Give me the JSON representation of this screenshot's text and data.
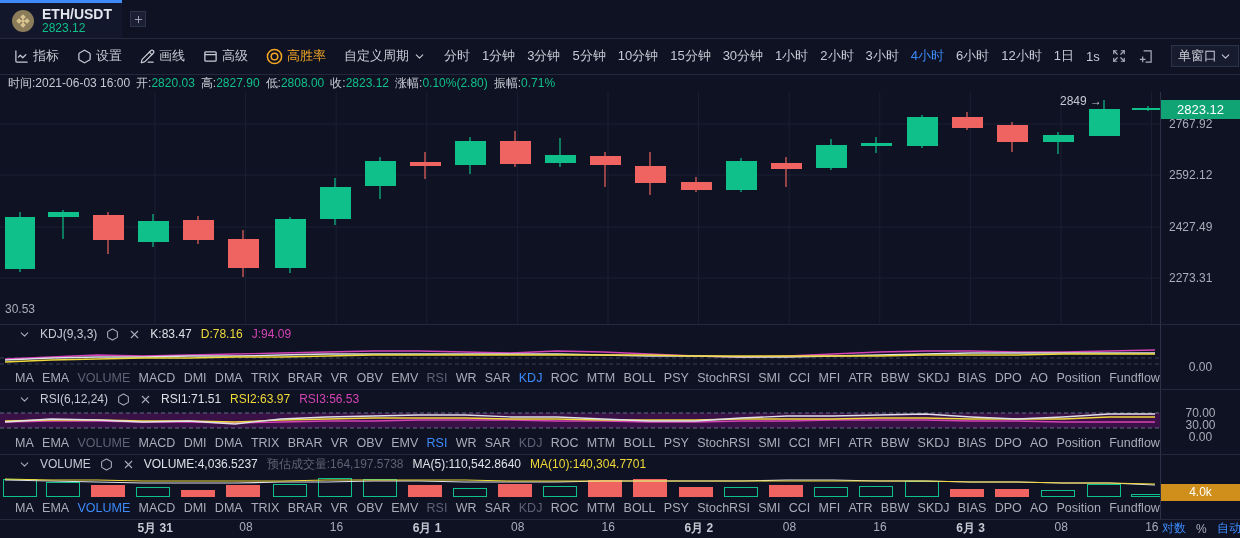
{
  "tab": {
    "symbol": "ETH/USDT",
    "price": "2823.12",
    "selected": true
  },
  "toolbar": {
    "tools": [
      {
        "kind": "indicator",
        "label": "指标"
      },
      {
        "kind": "settings",
        "label": "设置"
      },
      {
        "kind": "draw",
        "label": "画线"
      },
      {
        "kind": "advanced",
        "label": "高级"
      },
      {
        "kind": "winrate",
        "label": "高胜率"
      }
    ],
    "custom_period": "自定义周期",
    "intervals": [
      {
        "label": "分时",
        "selected": false
      },
      {
        "label": "1分钟",
        "selected": false
      },
      {
        "label": "3分钟",
        "selected": false
      },
      {
        "label": "5分钟",
        "selected": false
      },
      {
        "label": "10分钟",
        "selected": false
      },
      {
        "label": "15分钟",
        "selected": false
      },
      {
        "label": "30分钟",
        "selected": false
      },
      {
        "label": "1小时",
        "selected": false
      },
      {
        "label": "2小时",
        "selected": false
      },
      {
        "label": "3小时",
        "selected": false
      },
      {
        "label": "4小时",
        "selected": true
      },
      {
        "label": "6小时",
        "selected": false
      },
      {
        "label": "12小时",
        "selected": false
      },
      {
        "label": "1日",
        "selected": false
      },
      {
        "label": "1s",
        "selected": false
      }
    ],
    "layout_button": "单窗口"
  },
  "info": [
    {
      "label": "时间:",
      "value": "2021-06-03 16:00",
      "kind": "plain"
    },
    {
      "label": "开:",
      "value": "2820.03",
      "kind": "up"
    },
    {
      "label": "高:",
      "value": "2827.90",
      "kind": "up"
    },
    {
      "label": "低:",
      "value": "2808.00",
      "kind": "up"
    },
    {
      "label": "收:",
      "value": "2823.12",
      "kind": "up"
    },
    {
      "label": "涨幅:",
      "value": "0.10%(2.80)",
      "kind": "up"
    },
    {
      "label": "振幅:",
      "value": "0.71%",
      "kind": "up"
    }
  ],
  "main_chart": {
    "high_marker": "2849 →",
    "last_price": "2823.12",
    "price_axis": [
      "2767.92",
      "2592.12",
      "2427.49",
      "2273.31"
    ],
    "left_axis_label": "30.53"
  },
  "panels": [
    {
      "kind": "kdj",
      "title": "KDJ(9,3,3)",
      "values": [
        {
          "text": "K:83.47",
          "color": "#dfe1e8"
        },
        {
          "text": "D:78.16",
          "color": "#f0d93a"
        },
        {
          "text": "J:94.09",
          "color": "#d443b6"
        }
      ],
      "axis": [
        {
          "text": "0.00",
          "kind": "label"
        }
      ],
      "tabs": [
        {
          "label": "MA",
          "selected": false,
          "disabled": false
        },
        {
          "label": "EMA",
          "selected": false,
          "disabled": false
        },
        {
          "label": "VOLUME",
          "selected": false,
          "disabled": true
        },
        {
          "label": "MACD",
          "selected": false,
          "disabled": false
        },
        {
          "label": "DMI",
          "selected": false,
          "disabled": false
        },
        {
          "label": "DMA",
          "selected": false,
          "disabled": false
        },
        {
          "label": "TRIX",
          "selected": false,
          "disabled": false
        },
        {
          "label": "BRAR",
          "selected": false,
          "disabled": false
        },
        {
          "label": "VR",
          "selected": false,
          "disabled": false
        },
        {
          "label": "OBV",
          "selected": false,
          "disabled": false
        },
        {
          "label": "EMV",
          "selected": false,
          "disabled": false
        },
        {
          "label": "RSI",
          "selected": false,
          "disabled": true
        },
        {
          "label": "WR",
          "selected": false,
          "disabled": false
        },
        {
          "label": "SAR",
          "selected": false,
          "disabled": false
        },
        {
          "label": "KDJ",
          "selected": true,
          "disabled": false
        },
        {
          "label": "ROC",
          "selected": false,
          "disabled": false
        },
        {
          "label": "MTM",
          "selected": false,
          "disabled": false
        },
        {
          "label": "BOLL",
          "selected": false,
          "disabled": false
        },
        {
          "label": "PSY",
          "selected": false,
          "disabled": false
        },
        {
          "label": "StochRSI",
          "selected": false,
          "disabled": false
        },
        {
          "label": "SMI",
          "selected": false,
          "disabled": false
        },
        {
          "label": "CCI",
          "selected": false,
          "disabled": false
        },
        {
          "label": "MFI",
          "selected": false,
          "disabled": false
        },
        {
          "label": "ATR",
          "selected": false,
          "disabled": false
        },
        {
          "label": "BBW",
          "selected": false,
          "disabled": false
        },
        {
          "label": "SKDJ",
          "selected": false,
          "disabled": false
        },
        {
          "label": "BIAS",
          "selected": false,
          "disabled": false
        },
        {
          "label": "DPO",
          "selected": false,
          "disabled": false
        },
        {
          "label": "AO",
          "selected": false,
          "disabled": false
        },
        {
          "label": "Position",
          "selected": false,
          "disabled": false
        },
        {
          "label": "Fundflow",
          "selected": false,
          "disabled": false
        }
      ]
    },
    {
      "kind": "rsi",
      "title": "RSI(6,12,24)",
      "values": [
        {
          "text": "RSI1:71.51",
          "color": "#dfe1e8"
        },
        {
          "text": "RSI2:63.97",
          "color": "#f0d93a"
        },
        {
          "text": "RSI3:56.53",
          "color": "#d443b6"
        }
      ],
      "axis": [
        {
          "text": "70.00",
          "kind": "label"
        },
        {
          "text": "30.00",
          "kind": "label"
        },
        {
          "text": "0.00",
          "kind": "label"
        }
      ],
      "tabs": [
        {
          "label": "MA",
          "selected": false,
          "disabled": false
        },
        {
          "label": "EMA",
          "selected": false,
          "disabled": false
        },
        {
          "label": "VOLUME",
          "selected": false,
          "disabled": true
        },
        {
          "label": "MACD",
          "selected": false,
          "disabled": false
        },
        {
          "label": "DMI",
          "selected": false,
          "disabled": false
        },
        {
          "label": "DMA",
          "selected": false,
          "disabled": false
        },
        {
          "label": "TRIX",
          "selected": false,
          "disabled": false
        },
        {
          "label": "BRAR",
          "selected": false,
          "disabled": false
        },
        {
          "label": "VR",
          "selected": false,
          "disabled": false
        },
        {
          "label": "OBV",
          "selected": false,
          "disabled": false
        },
        {
          "label": "EMV",
          "selected": false,
          "disabled": false
        },
        {
          "label": "RSI",
          "selected": true,
          "disabled": false
        },
        {
          "label": "WR",
          "selected": false,
          "disabled": false
        },
        {
          "label": "SAR",
          "selected": false,
          "disabled": false
        },
        {
          "label": "KDJ",
          "selected": false,
          "disabled": true
        },
        {
          "label": "ROC",
          "selected": false,
          "disabled": false
        },
        {
          "label": "MTM",
          "selected": false,
          "disabled": false
        },
        {
          "label": "BOLL",
          "selected": false,
          "disabled": false
        },
        {
          "label": "PSY",
          "selected": false,
          "disabled": false
        },
        {
          "label": "StochRSI",
          "selected": false,
          "disabled": false
        },
        {
          "label": "SMI",
          "selected": false,
          "disabled": false
        },
        {
          "label": "CCI",
          "selected": false,
          "disabled": false
        },
        {
          "label": "MFI",
          "selected": false,
          "disabled": false
        },
        {
          "label": "ATR",
          "selected": false,
          "disabled": false
        },
        {
          "label": "BBW",
          "selected": false,
          "disabled": false
        },
        {
          "label": "SKDJ",
          "selected": false,
          "disabled": false
        },
        {
          "label": "BIAS",
          "selected": false,
          "disabled": false
        },
        {
          "label": "DPO",
          "selected": false,
          "disabled": false
        },
        {
          "label": "AO",
          "selected": false,
          "disabled": false
        },
        {
          "label": "Position",
          "selected": false,
          "disabled": false
        },
        {
          "label": "Fundflow",
          "selected": false,
          "disabled": false
        }
      ]
    },
    {
      "kind": "volume",
      "title": "VOLUME",
      "values": [
        {
          "text": "VOLUME:4,036.5237",
          "color": "#dfe1e8"
        },
        {
          "text": "预估成交量:164,197.5738",
          "color": "#5d6274"
        },
        {
          "text": "MA(5):110,542.8640",
          "color": "#dfe1e8"
        },
        {
          "text": "MA(10):140,304.7701",
          "color": "#f0d93a"
        }
      ],
      "axis": [
        {
          "text": "4.0k",
          "kind": "badge"
        }
      ],
      "tabs": [
        {
          "label": "MA",
          "selected": false,
          "disabled": false
        },
        {
          "label": "EMA",
          "selected": false,
          "disabled": false
        },
        {
          "label": "VOLUME",
          "selected": true,
          "disabled": false
        },
        {
          "label": "MACD",
          "selected": false,
          "disabled": false
        },
        {
          "label": "DMI",
          "selected": false,
          "disabled": false
        },
        {
          "label": "DMA",
          "selected": false,
          "disabled": false
        },
        {
          "label": "TRIX",
          "selected": false,
          "disabled": false
        },
        {
          "label": "BRAR",
          "selected": false,
          "disabled": false
        },
        {
          "label": "VR",
          "selected": false,
          "disabled": false
        },
        {
          "label": "OBV",
          "selected": false,
          "disabled": false
        },
        {
          "label": "EMV",
          "selected": false,
          "disabled": false
        },
        {
          "label": "RSI",
          "selected": false,
          "disabled": true
        },
        {
          "label": "WR",
          "selected": false,
          "disabled": false
        },
        {
          "label": "SAR",
          "selected": false,
          "disabled": false
        },
        {
          "label": "KDJ",
          "selected": false,
          "disabled": true
        },
        {
          "label": "ROC",
          "selected": false,
          "disabled": false
        },
        {
          "label": "MTM",
          "selected": false,
          "disabled": false
        },
        {
          "label": "BOLL",
          "selected": false,
          "disabled": false
        },
        {
          "label": "PSY",
          "selected": false,
          "disabled": false
        },
        {
          "label": "StochRSI",
          "selected": false,
          "disabled": false
        },
        {
          "label": "SMI",
          "selected": false,
          "disabled": false
        },
        {
          "label": "CCI",
          "selected": false,
          "disabled": false
        },
        {
          "label": "MFI",
          "selected": false,
          "disabled": false
        },
        {
          "label": "ATR",
          "selected": false,
          "disabled": false
        },
        {
          "label": "BBW",
          "selected": false,
          "disabled": false
        },
        {
          "label": "SKDJ",
          "selected": false,
          "disabled": false
        },
        {
          "label": "BIAS",
          "selected": false,
          "disabled": false
        },
        {
          "label": "DPO",
          "selected": false,
          "disabled": false
        },
        {
          "label": "AO",
          "selected": false,
          "disabled": false
        },
        {
          "label": "Position",
          "selected": false,
          "disabled": false
        },
        {
          "label": "Fundflow",
          "selected": false,
          "disabled": false
        }
      ]
    }
  ],
  "time_axis": [
    {
      "label": "5月 31",
      "kind": "day"
    },
    {
      "label": "08",
      "kind": "hour"
    },
    {
      "label": "16",
      "kind": "hour"
    },
    {
      "label": "6月 1",
      "kind": "day"
    },
    {
      "label": "08",
      "kind": "hour"
    },
    {
      "label": "16",
      "kind": "hour"
    },
    {
      "label": "6月 2",
      "kind": "day"
    },
    {
      "label": "08",
      "kind": "hour"
    },
    {
      "label": "16",
      "kind": "hour"
    },
    {
      "label": "6月 3",
      "kind": "day"
    },
    {
      "label": "08",
      "kind": "hour"
    },
    {
      "label": "16",
      "kind": "hour"
    }
  ],
  "scale_options": [
    {
      "label": "对数",
      "selected": true
    },
    {
      "label": "%",
      "selected": false
    },
    {
      "label": "自动",
      "selected": true
    }
  ]
}
